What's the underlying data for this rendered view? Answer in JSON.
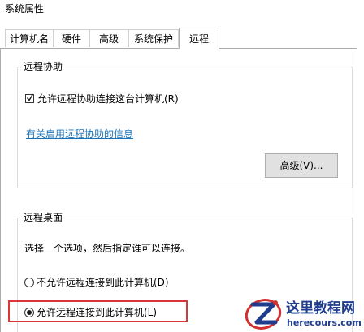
{
  "window": {
    "title": "系统属性"
  },
  "tabs": [
    {
      "label": "计算机名",
      "active": false
    },
    {
      "label": "硬件",
      "active": false
    },
    {
      "label": "高级",
      "active": false
    },
    {
      "label": "系统保护",
      "active": false
    },
    {
      "label": "远程",
      "active": true
    }
  ],
  "remote_assistance": {
    "group_title": "远程协助",
    "allow_checkbox_label": "允许远程协助连接这台计算机(R)",
    "allow_checked": true,
    "info_link": "有关启用远程协助的信息",
    "advanced_button": "高级(V)..."
  },
  "remote_desktop": {
    "group_title": "远程桌面",
    "instruction": "选择一个选项，然后指定谁可以连接。",
    "options": [
      {
        "label": "不允许远程连接到此计算机(D)",
        "selected": false
      },
      {
        "label": "允许远程连接到此计算机(L)",
        "selected": true
      }
    ]
  },
  "watermark": {
    "site_name": "这里教程网",
    "domain": "herecours.com"
  },
  "colors": {
    "highlight": "#d9383a",
    "link": "#1a73b8",
    "watermark": "#1f3d8c"
  }
}
